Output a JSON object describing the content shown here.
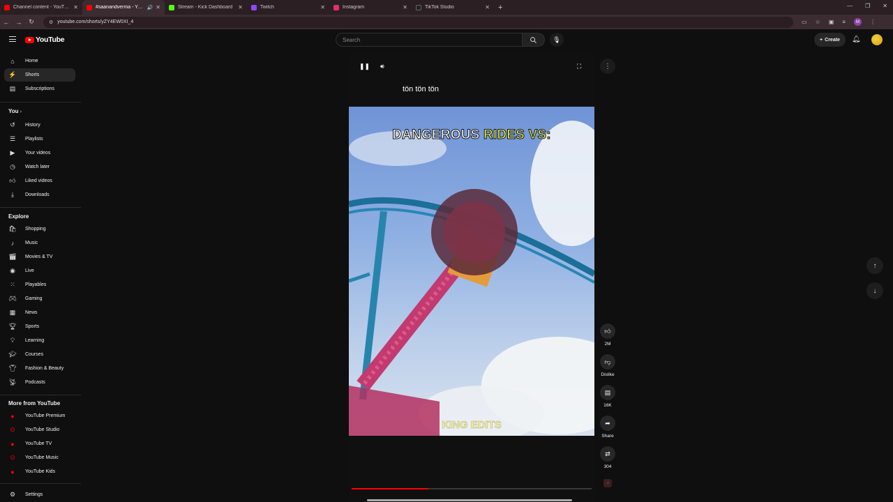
{
  "browser": {
    "tabs": [
      {
        "label": "Channel content - YouTube Studio",
        "color": "#ff0000"
      },
      {
        "label": "#saanandverma - YouTube",
        "color": "#ff0000"
      },
      {
        "label": "Stream - Kick Dashboard",
        "color": "#53fc18"
      },
      {
        "label": "Twitch",
        "color": "#9146ff"
      },
      {
        "label": "Instagram",
        "color": "#e1306c"
      },
      {
        "label": "TikTok Studio",
        "color": "#222222"
      }
    ],
    "url": "youtube.com/shorts/yZY4EW0XI_4",
    "profile_initial": "M"
  },
  "header": {
    "logo_text": "YouTube",
    "search_placeholder": "Search",
    "create_label": "Create"
  },
  "sidebar": {
    "main": [
      {
        "label": "Home",
        "icon": "home-icon"
      },
      {
        "label": "Shorts",
        "icon": "shorts-icon",
        "active": true
      },
      {
        "label": "Subscriptions",
        "icon": "subscriptions-icon"
      }
    ],
    "you_heading": "You",
    "you": [
      {
        "label": "History",
        "icon": "history-icon"
      },
      {
        "label": "Playlists",
        "icon": "playlists-icon"
      },
      {
        "label": "Your videos",
        "icon": "your-videos-icon"
      },
      {
        "label": "Watch later",
        "icon": "watch-later-icon"
      },
      {
        "label": "Liked videos",
        "icon": "liked-videos-icon"
      },
      {
        "label": "Downloads",
        "icon": "downloads-icon"
      }
    ],
    "explore_heading": "Explore",
    "explore": [
      {
        "label": "Shopping",
        "icon": "shopping-icon"
      },
      {
        "label": "Music",
        "icon": "music-icon"
      },
      {
        "label": "Movies & TV",
        "icon": "movies-icon"
      },
      {
        "label": "Live",
        "icon": "live-icon"
      },
      {
        "label": "Playables",
        "icon": "playables-icon"
      },
      {
        "label": "Gaming",
        "icon": "gaming-icon"
      },
      {
        "label": "News",
        "icon": "news-icon"
      },
      {
        "label": "Sports",
        "icon": "sports-icon"
      },
      {
        "label": "Learning",
        "icon": "learning-icon"
      },
      {
        "label": "Courses",
        "icon": "courses-icon"
      },
      {
        "label": "Fashion & Beauty",
        "icon": "fashion-icon"
      },
      {
        "label": "Podcasts",
        "icon": "podcasts-icon"
      }
    ],
    "more_heading": "More from YouTube",
    "more": [
      {
        "label": "YouTube Premium",
        "icon": "youtube-premium-icon"
      },
      {
        "label": "YouTube Studio",
        "icon": "youtube-studio-icon"
      },
      {
        "label": "YouTube TV",
        "icon": "youtube-tv-icon"
      },
      {
        "label": "YouTube Music",
        "icon": "youtube-music-icon"
      },
      {
        "label": "YouTube Kids",
        "icon": "youtube-kids-icon"
      }
    ],
    "settings_label": "Settings"
  },
  "player": {
    "subtitle": "tön tön tön",
    "headline_a": "DANGEROUS ",
    "headline_b": "RIDES VS:",
    "watermark": "KING EDITS",
    "progress_fraction": 0.32
  },
  "actions": {
    "likes": "2M",
    "dislike_label": "Dislike",
    "comments": "16K",
    "share_label": "Share",
    "remix_count": "304"
  },
  "colors": {
    "accent": "#ff0000",
    "background": "#0f0f0f",
    "headline_highlight": "#e8ef4a"
  }
}
